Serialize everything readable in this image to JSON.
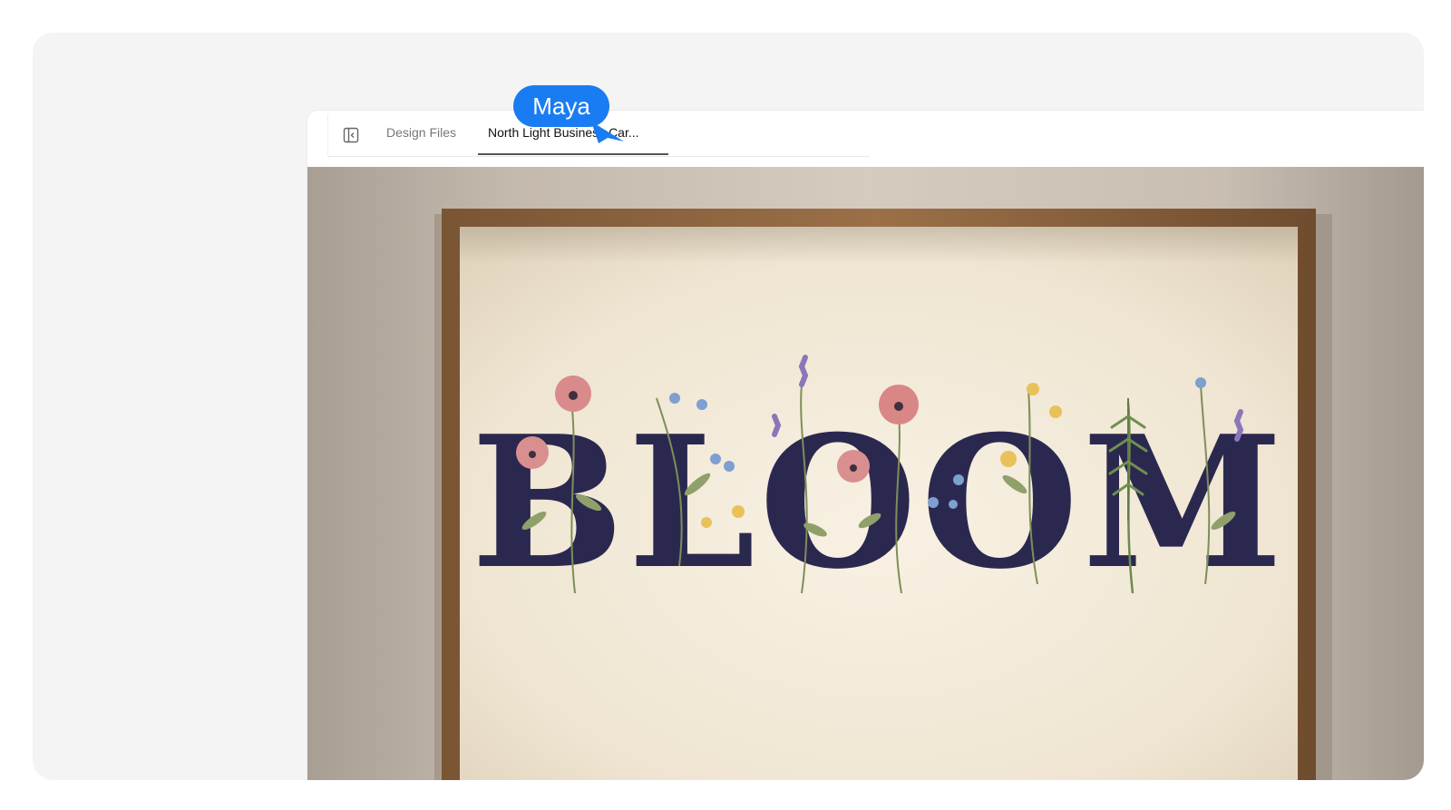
{
  "tabs": {
    "design_files": "Design Files",
    "active_tab": "North Light Business Car..."
  },
  "collaborator": {
    "name": "Maya",
    "color": "#1a7cf2"
  },
  "artwork": {
    "word": "BLOOM"
  },
  "icons": {
    "panel_toggle": "sidebar-toggle-icon"
  }
}
